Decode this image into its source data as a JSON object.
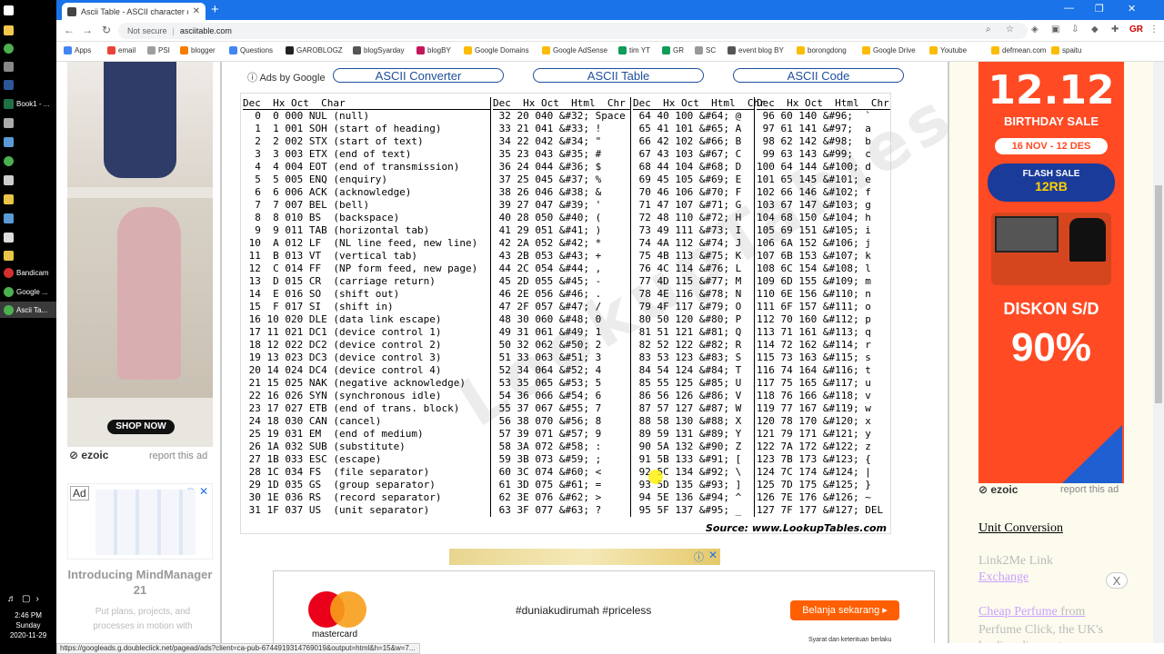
{
  "taskbar": {
    "items": [
      {
        "label": "",
        "icon": "windows-start-icon"
      },
      {
        "label": "",
        "icon": "file-explorer-icon"
      },
      {
        "label": "",
        "icon": "chrome-icon"
      },
      {
        "label": "",
        "icon": "app-icon"
      },
      {
        "label": "",
        "icon": "word-icon"
      },
      {
        "label": "Book1 - ...",
        "icon": "excel-icon"
      },
      {
        "label": "",
        "icon": "app-icon"
      },
      {
        "label": "",
        "icon": "app-icon"
      },
      {
        "label": "",
        "icon": "chrome-icon"
      },
      {
        "label": "",
        "icon": "app-icon"
      },
      {
        "label": "",
        "icon": "app-icon"
      },
      {
        "label": "",
        "icon": "app-icon"
      },
      {
        "label": "",
        "icon": "app-icon"
      },
      {
        "label": "",
        "icon": "app-icon"
      },
      {
        "label": "Bandicam",
        "icon": "bandicam-icon"
      },
      {
        "label": "Google ...",
        "icon": "chrome-icon"
      },
      {
        "label": "Ascii Ta...",
        "icon": "chrome-icon"
      }
    ],
    "time": "2:46 PM",
    "day": "Sunday",
    "date": "2020-11-29"
  },
  "browser": {
    "tab_title": "Ascii Table - ASCII character codes",
    "security": "Not secure",
    "url": "asciitable.com",
    "bookmarks": [
      "Apps",
      "email",
      "PSI",
      "blogger",
      "Questions",
      "GAROBLOGZ",
      "blogSyarday",
      "blogBY",
      "Google Domains",
      "Google AdSense",
      "tim YT",
      "GR",
      "SC",
      "event blog BY",
      "borongdong",
      "Google Drive",
      "Youtube",
      "defmean.com",
      "spaitu"
    ]
  },
  "left_ad": {
    "shop_label": "SHOP NOW",
    "ezoic": "ezoic",
    "report": "report this ad",
    "ad_badge": "Ad",
    "title": "Introducing MindManager 21",
    "text": "Put plans, projects, and processes in motion with"
  },
  "nav": {
    "ads_by": "Ads by Google",
    "buttons": [
      "ASCII Converter",
      "ASCII Table",
      "ASCII Code"
    ]
  },
  "ascii_table": {
    "headers": [
      "Dec  Hx Oct  Char",
      "Dec  Hx Oct  Html  Chr",
      "Dec  Hx Oct  Html  Chr",
      "Dec  Hx Oct  Html  Chr"
    ],
    "col1": [
      "  0  0 000 NUL (null)",
      "  1  1 001 SOH (start of heading)",
      "  2  2 002 STX (start of text)",
      "  3  3 003 ETX (end of text)",
      "  4  4 004 EOT (end of transmission)",
      "  5  5 005 ENQ (enquiry)",
      "  6  6 006 ACK (acknowledge)",
      "  7  7 007 BEL (bell)",
      "  8  8 010 BS  (backspace)",
      "  9  9 011 TAB (horizontal tab)",
      " 10  A 012 LF  (NL line feed, new line)",
      " 11  B 013 VT  (vertical tab)",
      " 12  C 014 FF  (NP form feed, new page)",
      " 13  D 015 CR  (carriage return)",
      " 14  E 016 SO  (shift out)",
      " 15  F 017 SI  (shift in)",
      " 16 10 020 DLE (data link escape)",
      " 17 11 021 DC1 (device control 1)",
      " 18 12 022 DC2 (device control 2)",
      " 19 13 023 DC3 (device control 3)",
      " 20 14 024 DC4 (device control 4)",
      " 21 15 025 NAK (negative acknowledge)",
      " 22 16 026 SYN (synchronous idle)",
      " 23 17 027 ETB (end of trans. block)",
      " 24 18 030 CAN (cancel)",
      " 25 19 031 EM  (end of medium)",
      " 26 1A 032 SUB (substitute)",
      " 27 1B 033 ESC (escape)",
      " 28 1C 034 FS  (file separator)",
      " 29 1D 035 GS  (group separator)",
      " 30 1E 036 RS  (record separator)",
      " 31 1F 037 US  (unit separator)"
    ],
    "col2": [
      " 32 20 040 &#32; Space",
      " 33 21 041 &#33; !",
      " 34 22 042 &#34; \"",
      " 35 23 043 &#35; #",
      " 36 24 044 &#36; $",
      " 37 25 045 &#37; %",
      " 38 26 046 &#38; &",
      " 39 27 047 &#39; '",
      " 40 28 050 &#40; (",
      " 41 29 051 &#41; )",
      " 42 2A 052 &#42; *",
      " 43 2B 053 &#43; +",
      " 44 2C 054 &#44; ,",
      " 45 2D 055 &#45; -",
      " 46 2E 056 &#46; .",
      " 47 2F 057 &#47; /",
      " 48 30 060 &#48; 0",
      " 49 31 061 &#49; 1",
      " 50 32 062 &#50; 2",
      " 51 33 063 &#51; 3",
      " 52 34 064 &#52; 4",
      " 53 35 065 &#53; 5",
      " 54 36 066 &#54; 6",
      " 55 37 067 &#55; 7",
      " 56 38 070 &#56; 8",
      " 57 39 071 &#57; 9",
      " 58 3A 072 &#58; :",
      " 59 3B 073 &#59; ;",
      " 60 3C 074 &#60; <",
      " 61 3D 075 &#61; =",
      " 62 3E 076 &#62; >",
      " 63 3F 077 &#63; ?"
    ],
    "col3": [
      " 64 40 100 &#64; @",
      " 65 41 101 &#65; A",
      " 66 42 102 &#66; B",
      " 67 43 103 &#67; C",
      " 68 44 104 &#68; D",
      " 69 45 105 &#69; E",
      " 70 46 106 &#70; F",
      " 71 47 107 &#71; G",
      " 72 48 110 &#72; H",
      " 73 49 111 &#73; I",
      " 74 4A 112 &#74; J",
      " 75 4B 113 &#75; K",
      " 76 4C 114 &#76; L",
      " 77 4D 115 &#77; M",
      " 78 4E 116 &#78; N",
      " 79 4F 117 &#79; O",
      " 80 50 120 &#80; P",
      " 81 51 121 &#81; Q",
      " 82 52 122 &#82; R",
      " 83 53 123 &#83; S",
      " 84 54 124 &#84; T",
      " 85 55 125 &#85; U",
      " 86 56 126 &#86; V",
      " 87 57 127 &#87; W",
      " 88 58 130 &#88; X",
      " 89 59 131 &#89; Y",
      " 90 5A 132 &#90; Z",
      " 91 5B 133 &#91; [",
      " 92 5C 134 &#92; \\",
      " 93 5D 135 &#93; ]",
      " 94 5E 136 &#94; ^",
      " 95 5F 137 &#95; _"
    ],
    "col4": [
      " 96 60 140 &#96;  `",
      " 97 61 141 &#97;  a",
      " 98 62 142 &#98;  b",
      " 99 63 143 &#99;  c",
      "100 64 144 &#100; d",
      "101 65 145 &#101; e",
      "102 66 146 &#102; f",
      "103 67 147 &#103; g",
      "104 68 150 &#104; h",
      "105 69 151 &#105; i",
      "106 6A 152 &#106; j",
      "107 6B 153 &#107; k",
      "108 6C 154 &#108; l",
      "109 6D 155 &#109; m",
      "110 6E 156 &#110; n",
      "111 6F 157 &#111; o",
      "112 70 160 &#112; p",
      "113 71 161 &#113; q",
      "114 72 162 &#114; r",
      "115 73 163 &#115; s",
      "116 74 164 &#116; t",
      "117 75 165 &#117; u",
      "118 76 166 &#118; v",
      "119 77 167 &#119; w",
      "120 78 170 &#120; x",
      "121 79 171 &#121; y",
      "122 7A 172 &#122; z",
      "123 7B 173 &#123; {",
      "124 7C 174 &#124; |",
      "125 7D 175 &#125; }",
      "126 7E 176 &#126; ~",
      "127 7F 177 &#127; DEL"
    ],
    "source": "Source:  www.LookupTables.com"
  },
  "bottom_ad": {
    "brand": "mastercard",
    "tags": "#duniakudirumah  #priceless",
    "button": "Belanja sekarang",
    "footnote": "Syarat dan ketentuan berlaku"
  },
  "right_ad": {
    "big": "12.12",
    "birthday": "BIRTHDAY SALE",
    "dates": "16 NOV - 12 DES",
    "flash": "FLASH SALE",
    "flash_amount": "12RB",
    "diskon": "DISKON S/D",
    "percent": "90%",
    "ezoic": "ezoic",
    "report": "report this ad"
  },
  "right_links": {
    "l1": "Unit Conversion",
    "l2": "Link2Me Link",
    "l3": "Exchange",
    "l4": "Cheap Perfume",
    "l4_suffix": " from",
    "more": "Perfume Click, the UK's leading discount",
    "close": "X"
  },
  "status_url": "https://googleads.g.doubleclick.net/pagead/ads?client=ca-pub-6744919314769019&output=html&h=15&w=7..."
}
